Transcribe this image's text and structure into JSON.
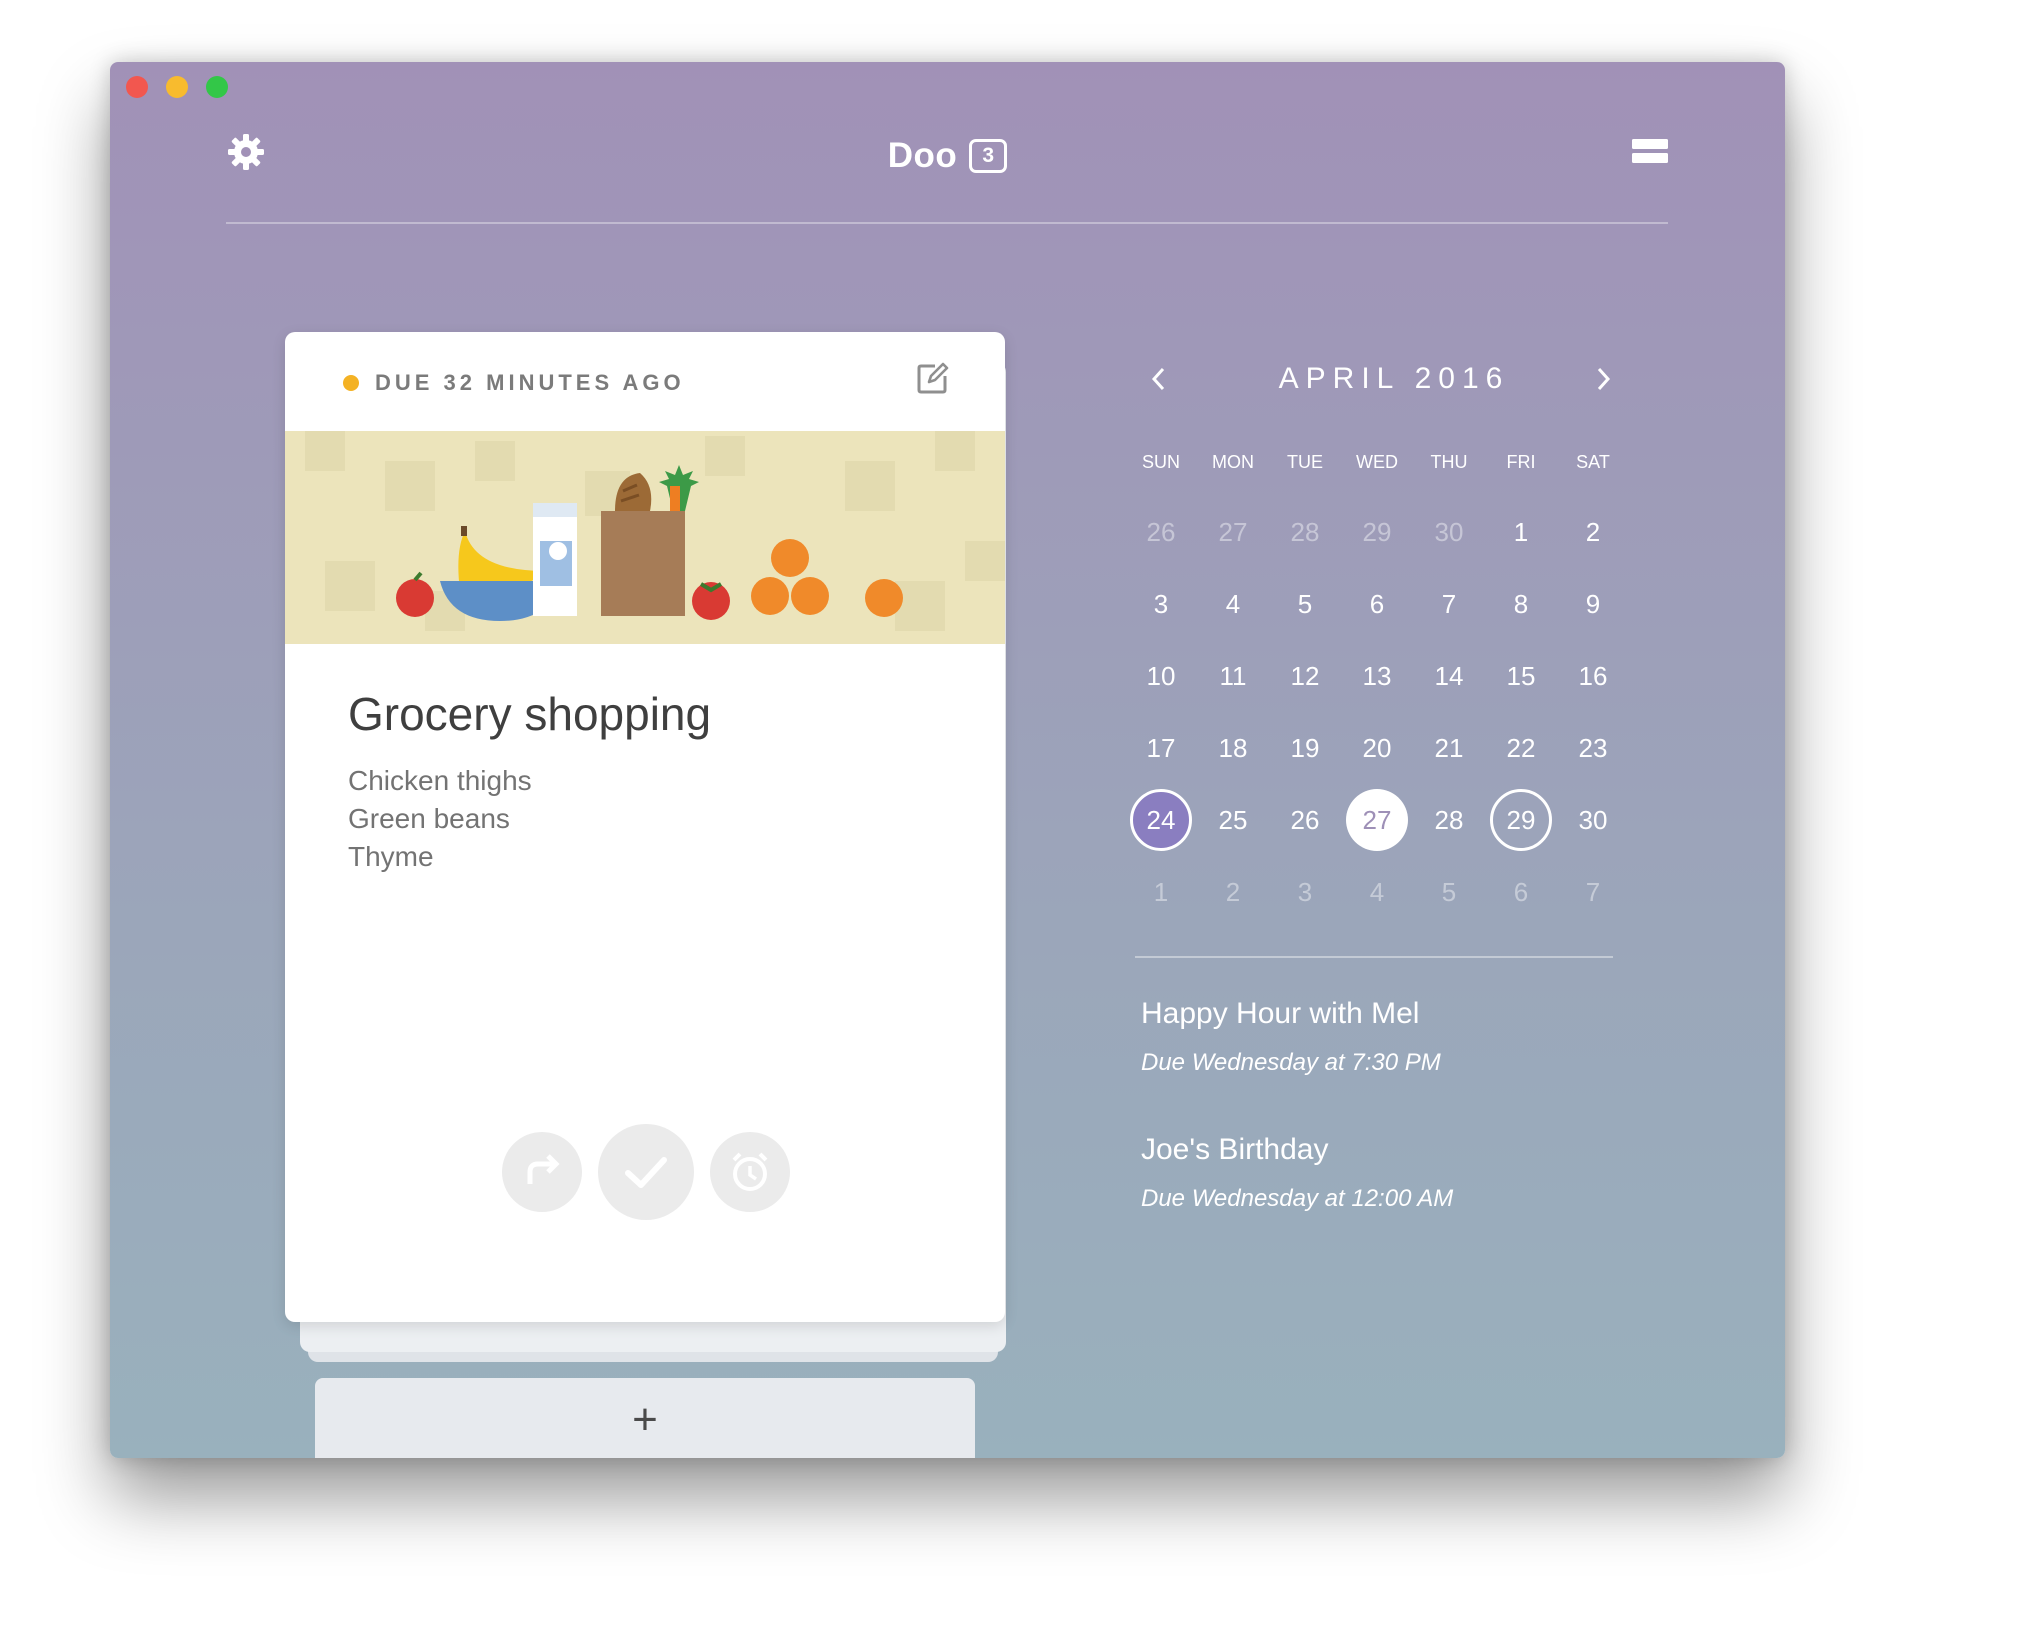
{
  "header": {
    "app_title": "Doo",
    "badge_count": "3"
  },
  "card": {
    "due_label": "DUE 32 MINUTES AGO",
    "due_color": "#f4b224",
    "title": "Grocery shopping",
    "notes": [
      "Chicken thighs",
      "Green beans",
      "Thyme"
    ]
  },
  "add_button": {
    "label": "+"
  },
  "calendar": {
    "month_label": "APRIL 2016",
    "weekdays": [
      "SUN",
      "MON",
      "TUE",
      "WED",
      "THU",
      "FRI",
      "SAT"
    ],
    "weeks": [
      [
        "26",
        "27",
        "28",
        "29",
        "30",
        "1",
        "2"
      ],
      [
        "3",
        "4",
        "5",
        "6",
        "7",
        "8",
        "9"
      ],
      [
        "10",
        "11",
        "12",
        "13",
        "14",
        "15",
        "16"
      ],
      [
        "17",
        "18",
        "19",
        "20",
        "21",
        "22",
        "23"
      ],
      [
        "24",
        "25",
        "26",
        "27",
        "28",
        "29",
        "30"
      ],
      [
        "1",
        "2",
        "3",
        "4",
        "5",
        "6",
        "7"
      ]
    ],
    "selected_day": "24",
    "today_day": "27",
    "marked_day": "29"
  },
  "events": [
    {
      "title": "Happy Hour with Mel",
      "due": "Due Wednesday at 7:30 PM"
    },
    {
      "title": "Joe's Birthday",
      "due": "Due Wednesday at 12:00 AM"
    }
  ],
  "icons": {
    "settings": "gear-icon",
    "menu": "menu-icon",
    "edit": "edit-icon",
    "forward": "forward-icon",
    "complete": "checkmark-icon",
    "snooze": "alarm-clock-icon",
    "prev_month": "chevron-left-icon",
    "next_month": "chevron-right-icon"
  },
  "colors": {
    "accent_selected": "#8a7ec0",
    "window_top": "#a191b7",
    "window_bottom": "#99b1bd"
  }
}
